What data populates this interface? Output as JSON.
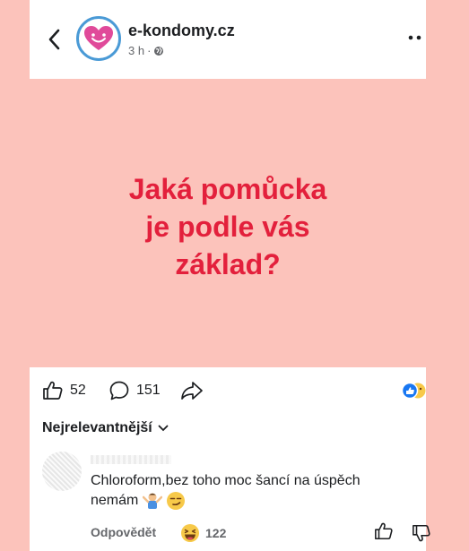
{
  "header": {
    "page_name": "e-kondomy.cz",
    "time": "3 h",
    "separator": "·"
  },
  "post": {
    "headline_lines": [
      "Jaká pomůcka",
      "je podle vás",
      "základ?"
    ]
  },
  "actions": {
    "likes": "52",
    "comments": "151"
  },
  "comments": {
    "sort_label": "Nejrelevantnější",
    "items": [
      {
        "text_line1": "Chloroform,bez toho moc šancí na úspěch",
        "text_line2": "nemám",
        "reply_label": "Odpovědět",
        "reaction_count": "122"
      }
    ]
  },
  "colors": {
    "background": "#fcc3bb",
    "headline": "#e3203c",
    "brand_heart": "#e04a9a",
    "avatar_ring": "#4a9ad6"
  }
}
